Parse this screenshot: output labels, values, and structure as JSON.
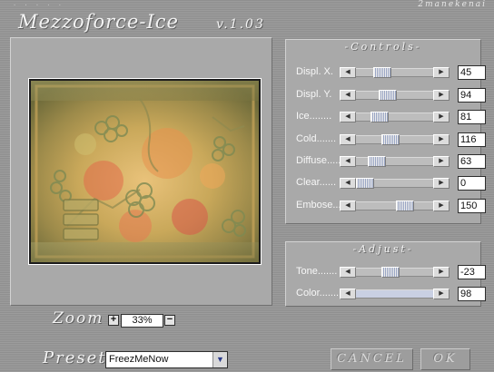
{
  "window": {
    "maker": "2manekenai",
    "title": "Mezzoforce-Ice",
    "version": "v.1.03"
  },
  "controls": {
    "title": "-Controls-",
    "rows": [
      {
        "label": "Displ. X.",
        "value": "45",
        "thumb_fraction": 0.36
      },
      {
        "label": "Displ. Y.",
        "value": "94",
        "thumb_fraction": 0.43
      },
      {
        "label": "Ice........",
        "value": "81",
        "thumb_fraction": 0.33
      },
      {
        "label": "Cold.......",
        "value": "116",
        "thumb_fraction": 0.46
      },
      {
        "label": "Diffuse.....",
        "value": "63",
        "thumb_fraction": 0.3
      },
      {
        "label": "Clear......",
        "value": "0",
        "thumb_fraction": 0.07
      },
      {
        "label": "Embose......",
        "value": "150",
        "thumb_fraction": 0.68
      }
    ]
  },
  "adjust": {
    "title": "-Adjust-",
    "rows": [
      {
        "label": "Tone.......",
        "value": "-23",
        "thumb_fraction": 0.46
      },
      {
        "label": "Color.......",
        "value": "98",
        "thumb_fraction": null
      }
    ]
  },
  "zoom": {
    "label": "Zoom",
    "value": "33%",
    "plus_icon": "plus-icon",
    "minus_icon": "minus-icon"
  },
  "preset": {
    "label": "Preset",
    "value": "FreezMeNow",
    "arrow_icon": "chevron-down-icon"
  },
  "buttons": {
    "cancel": "CANCEL",
    "ok": "OK"
  },
  "colors": {
    "background": "#979797",
    "panel": "#a9a9a9",
    "thumb_accent": "#9aa6c5",
    "active_track": "#c9d0e3"
  }
}
